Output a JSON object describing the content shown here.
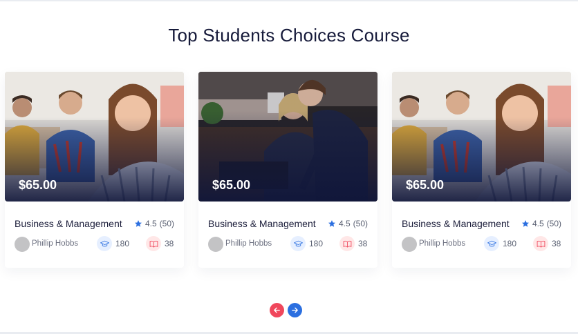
{
  "section": {
    "title": "Top Students Choices Course"
  },
  "cards": [
    {
      "price": "$65.00",
      "title": "Business & Management",
      "rating": "4.5",
      "reviews": "(50)",
      "author": "Phillip Hobbs",
      "students": "180",
      "lessons": "38",
      "image": "students-smiling"
    },
    {
      "price": "$65.00",
      "title": "Business & Management",
      "rating": "4.5",
      "reviews": "(50)",
      "author": "Phillip Hobbs",
      "students": "180",
      "lessons": "38",
      "image": "office-meeting"
    },
    {
      "price": "$65.00",
      "title": "Business & Management",
      "rating": "4.5",
      "reviews": "(50)",
      "author": "Phillip Hobbs",
      "students": "180",
      "lessons": "38",
      "image": "students-smiling"
    }
  ],
  "icons": {
    "rating": "star-icon",
    "students": "graduation-cap-icon",
    "lessons": "book-icon",
    "prev": "arrow-left-icon",
    "next": "arrow-right-icon"
  },
  "colors": {
    "accent_blue": "#2b6fe0",
    "accent_red": "#f0475c",
    "heading": "#161a3a"
  }
}
